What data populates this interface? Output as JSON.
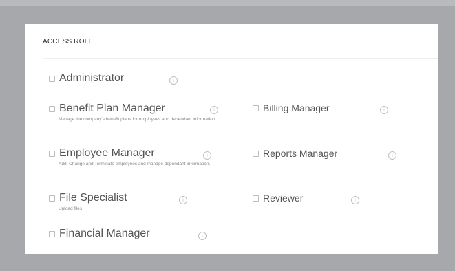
{
  "header": {
    "title": "ACCESS ROLE"
  },
  "roles": [
    {
      "label": "Administrator",
      "description": "",
      "info": "i"
    },
    {
      "label": "Benefit Plan Manager",
      "description": "Manage the company's benefit plans for employees and dependant information.",
      "info": "i"
    },
    {
      "label": "Billing Manager",
      "description": "",
      "info": "i"
    },
    {
      "label": "Employee Manager",
      "description": "Add, Change and Terminate employees and manage dependant information.",
      "info": "i"
    },
    {
      "label": "Reports Manager",
      "description": "",
      "info": "i"
    },
    {
      "label": "File Specialist",
      "description": "Upload files",
      "info": "i"
    },
    {
      "label": "Reviewer",
      "description": "",
      "info": "i"
    },
    {
      "label": "Financial Manager",
      "description": "",
      "info": "i"
    }
  ]
}
